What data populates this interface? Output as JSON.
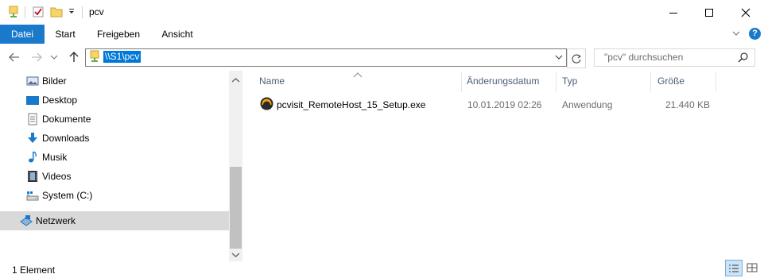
{
  "window": {
    "title": "pcv",
    "minimize_icon": "minimize-icon",
    "maximize_icon": "maximize-icon",
    "close_icon": "close-icon"
  },
  "ribbon": {
    "tabs": [
      {
        "label": "Datei",
        "active": true
      },
      {
        "label": "Start"
      },
      {
        "label": "Freigeben"
      },
      {
        "label": "Ansicht"
      }
    ],
    "accent": "#1979ca"
  },
  "address": {
    "path": "\\\\S1\\pcv",
    "search_placeholder": "\"pcv\" durchsuchen"
  },
  "sidebar": {
    "items": [
      {
        "label": "Bilder",
        "icon": "pictures-icon"
      },
      {
        "label": "Desktop",
        "icon": "desktop-icon"
      },
      {
        "label": "Dokumente",
        "icon": "documents-icon"
      },
      {
        "label": "Downloads",
        "icon": "downloads-icon"
      },
      {
        "label": "Musik",
        "icon": "music-icon"
      },
      {
        "label": "Videos",
        "icon": "videos-icon"
      },
      {
        "label": "System (C:)",
        "icon": "drive-icon"
      },
      {
        "label": "Netzwerk",
        "icon": "network-icon",
        "selected": true
      }
    ]
  },
  "files": {
    "columns": [
      "Name",
      "Änderungsdatum",
      "Typ",
      "Größe"
    ],
    "rows": [
      {
        "name": "pcvisit_RemoteHost_15_Setup.exe",
        "date": "10.01.2019 02:26",
        "type": "Anwendung",
        "size": "21.440 KB",
        "icon": "pcvisit-app-icon"
      }
    ]
  },
  "status": {
    "count": "1 Element"
  }
}
